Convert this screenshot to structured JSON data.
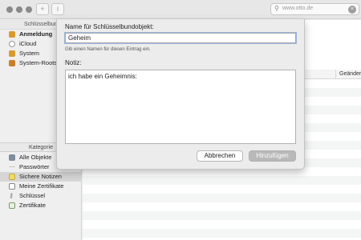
{
  "toolbar": {
    "search_value": "www.otto.de",
    "add_icon": "plus-icon",
    "info_icon": "info-icon"
  },
  "sidebar": {
    "header": "Schlüsselbund",
    "keychains": [
      {
        "label": "Anmeldung",
        "icon": "keychain-lock-icon",
        "color": "#d89b2b"
      },
      {
        "label": "iCloud",
        "icon": "cloud-icon",
        "color": "#ffffff"
      },
      {
        "label": "System",
        "icon": "keychain-lock-icon",
        "color": "#d89b2b"
      },
      {
        "label": "System-Roots",
        "icon": "keychain-lock-icon",
        "color": "#c97f2a"
      }
    ],
    "category_header": "Kategorie",
    "categories": [
      {
        "label": "Alle Objekte",
        "icon": "all-items-icon"
      },
      {
        "label": "Passwörter",
        "icon": "password-icon"
      },
      {
        "label": "Sichere Notizen",
        "icon": "secure-note-icon"
      },
      {
        "label": "Meine Zertifikate",
        "icon": "certificate-icon"
      },
      {
        "label": "Schlüssel",
        "icon": "key-icon"
      },
      {
        "label": "Zertifikate",
        "icon": "certificate-icon"
      }
    ]
  },
  "list": {
    "column_changed": "Geändert"
  },
  "dialog": {
    "name_label": "Name für Schlüsselbundobjekt:",
    "name_value": "Geheim",
    "name_hint": "Gib einen Namen für diesen Eintrag ein.",
    "note_label": "Notiz:",
    "note_value": "ich habe ein Geheimnis:",
    "cancel_label": "Abbrechen",
    "add_label": "Hinzufügen"
  }
}
